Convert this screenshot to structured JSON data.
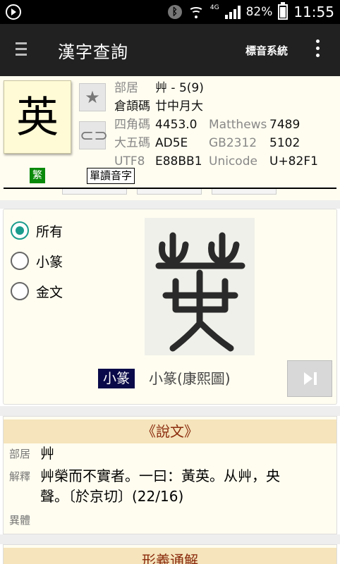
{
  "status_bar": {
    "network": "4G",
    "battery": "82%",
    "time": "11:55"
  },
  "app_bar": {
    "title": "漢字查詢",
    "system_button": "標音系統"
  },
  "character": {
    "glyph": "英",
    "traditional_badge": "繁",
    "single_reading_button": "單讀音字"
  },
  "info": {
    "radical_label": "部居",
    "radical_value": "艸 - 5(9)",
    "cangjie_label": "倉頡碼",
    "cangjie_value": "廿中月大",
    "four_corner_label": "四角碼",
    "four_corner_value": "4453.0",
    "matthews_label": "Matthews",
    "matthews_value": "7489",
    "big5_label": "大五碼",
    "big5_value": "AD5E",
    "gb_label": "GB2312",
    "gb_value": "5102",
    "utf8_label": "UTF8",
    "utf8_value": "E88BB1",
    "unicode_label": "Unicode",
    "unicode_value": "U+82F1"
  },
  "scripts": {
    "options": [
      "所有",
      "小篆",
      "金文"
    ],
    "selected": "所有",
    "current_label": "小篆",
    "current_source": "小篆(康熙圖)"
  },
  "shuowen": {
    "title": "《說文》",
    "radical_label": "部居",
    "radical_value": "艸",
    "explanation_label": "解釋",
    "explanation_line1": "艸榮而不實者。一曰：黃英。从艸，央",
    "explanation_line2": "聲。〔於京切〕(22/16)",
    "variant_label": "異體"
  },
  "next_section": {
    "title": "形義通解"
  },
  "colors": {
    "app_bar": "#212121",
    "accent_radio": "#1a9c8c",
    "section_title_bg": "#f5e4bc",
    "section_title_text": "#8a2b0c",
    "traditional_badge": "#0a8a0a"
  }
}
